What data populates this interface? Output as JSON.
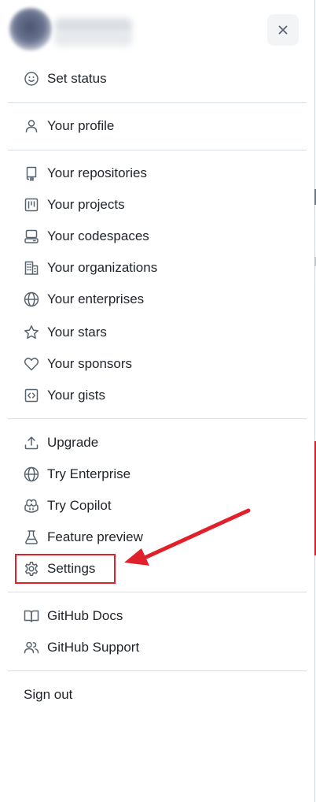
{
  "header": {
    "close_label": "Close"
  },
  "menu": {
    "set_status": "Set status",
    "your_profile": "Your profile",
    "your_repositories": "Your repositories",
    "your_projects": "Your projects",
    "your_codespaces": "Your codespaces",
    "your_organizations": "Your organizations",
    "your_enterprises": "Your enterprises",
    "your_stars": "Your stars",
    "your_sponsors": "Your sponsors",
    "your_gists": "Your gists",
    "upgrade": "Upgrade",
    "try_enterprise": "Try Enterprise",
    "try_copilot": "Try Copilot",
    "feature_preview": "Feature preview",
    "settings": "Settings",
    "github_docs": "GitHub Docs",
    "github_support": "GitHub Support",
    "sign_out": "Sign out"
  },
  "annotation": {
    "color": "#e0202a"
  }
}
